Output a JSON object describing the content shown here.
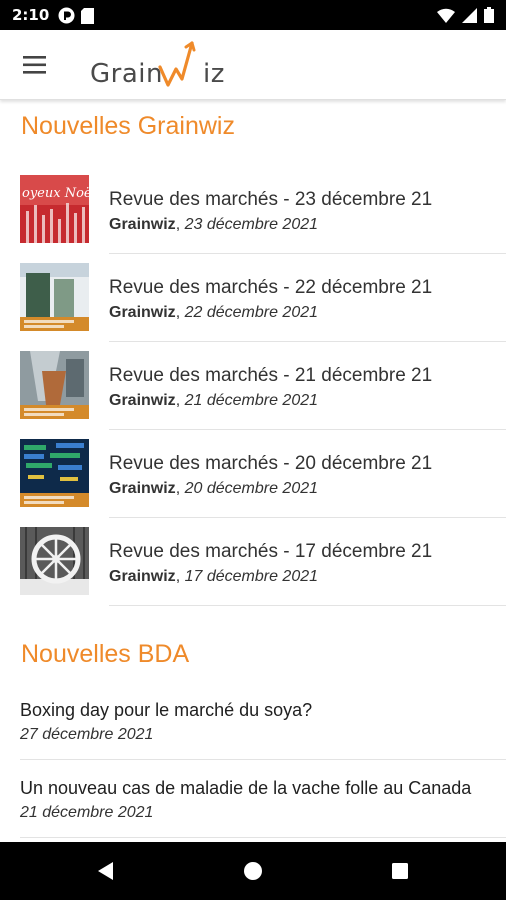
{
  "status_bar": {
    "time": "2:10",
    "left_icons": [
      "pocket-casts-icon",
      "sd-card-icon"
    ],
    "right_icons": [
      "wifi-icon",
      "cellular-signal-icon",
      "battery-icon"
    ]
  },
  "app_bar": {
    "menu_icon": "hamburger-menu-icon",
    "logo_text_left": "Grain",
    "logo_text_right": "iz"
  },
  "sections": {
    "grainwiz": {
      "title": "Nouvelles Grainwiz",
      "items": [
        {
          "title": "Revue des marchés - 23 décembre 21",
          "author": "Grainwiz",
          "date": "23 décembre 2021",
          "thumbnail": "christmas-card-thumbnail"
        },
        {
          "title": "Revue des marchés - 22 décembre 21",
          "author": "Grainwiz",
          "date": "22 décembre 2021",
          "thumbnail": "grain-silo-thumbnail"
        },
        {
          "title": "Revue des marchés - 21 décembre 21",
          "author": "Grainwiz",
          "date": "21 décembre 2021",
          "thumbnail": "grain-pouring-thumbnail"
        },
        {
          "title": "Revue des marchés - 20 décembre 21",
          "author": "Grainwiz",
          "date": "20 décembre 2021",
          "thumbnail": "market-board-thumbnail"
        },
        {
          "title": "Revue des marchés - 17 décembre 21",
          "author": "Grainwiz",
          "date": "17 décembre 2021",
          "thumbnail": "wagon-wheel-thumbnail"
        }
      ]
    },
    "bda": {
      "title": "Nouvelles BDA",
      "items": [
        {
          "title": "Boxing day pour le marché du soya?",
          "date": "27 décembre 2021"
        },
        {
          "title": "Un nouveau cas de maladie de la vache folle au Canada",
          "date": "21 décembre 2021"
        }
      ]
    }
  },
  "colors": {
    "accent": "#ef8a2a",
    "status_bar": "#000000",
    "nav_bar": "#000000"
  },
  "nav_bar": {
    "buttons": [
      "back-icon",
      "home-icon",
      "recents-icon"
    ]
  }
}
